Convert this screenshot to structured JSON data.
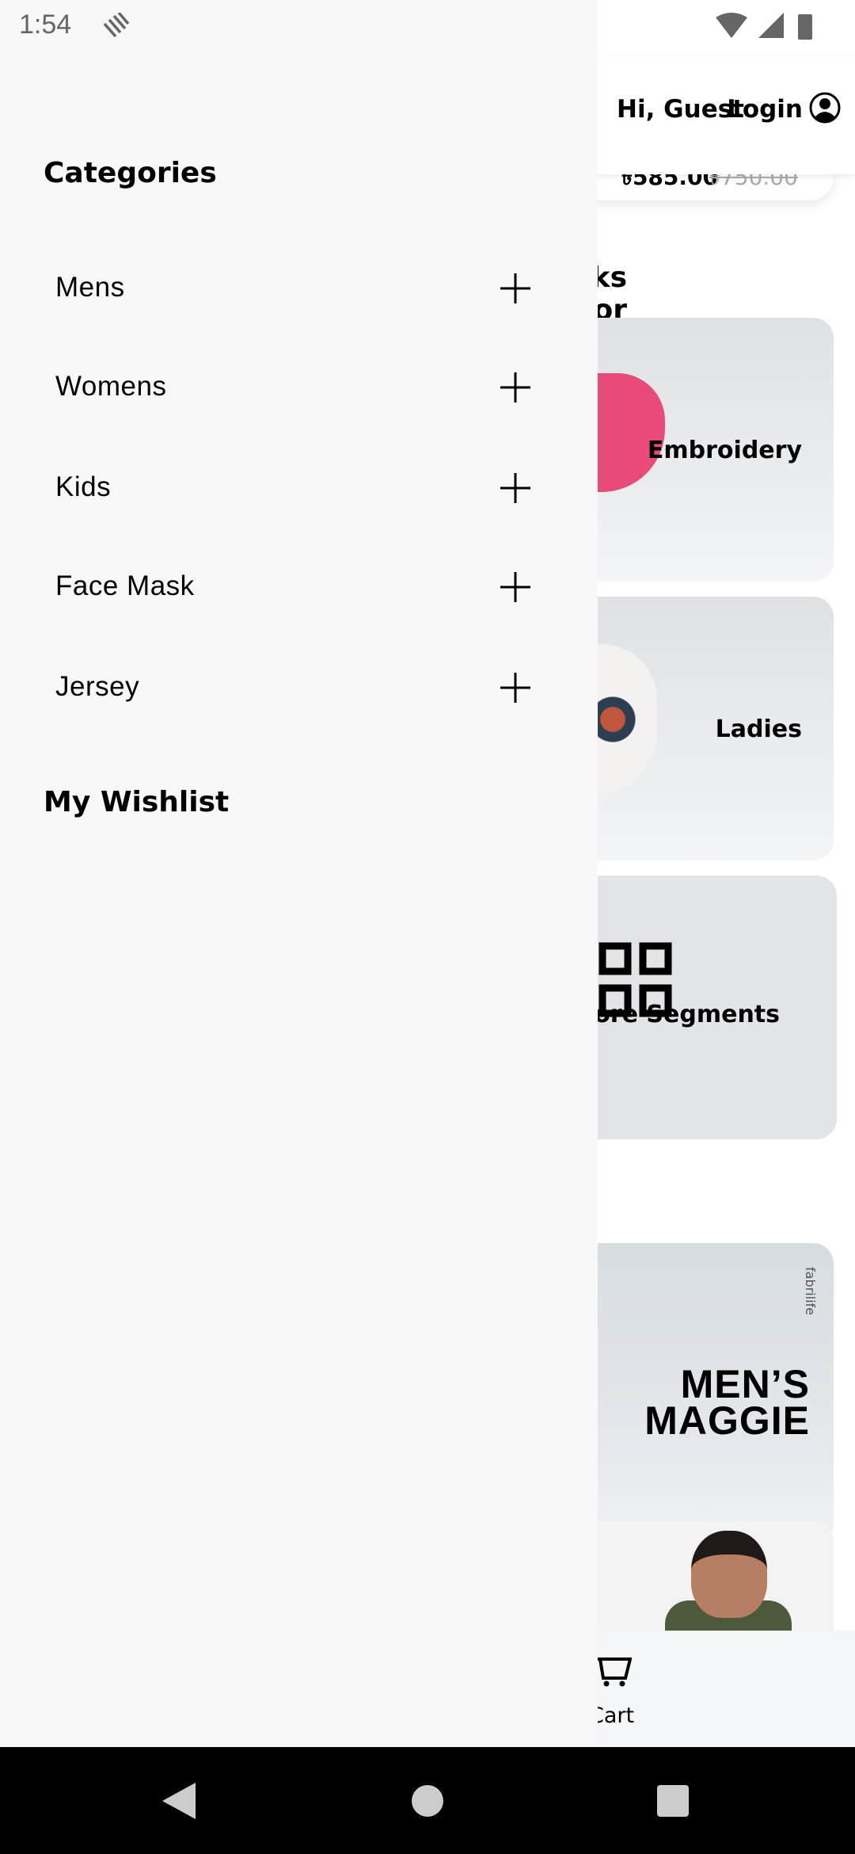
{
  "status_bar": {
    "time": "1:54",
    "icons": [
      "notification-icon",
      "wifi-icon",
      "signal-icon",
      "battery-icon"
    ]
  },
  "header": {
    "greeting": "Hi, Guest",
    "login_label": "Login",
    "icon": "account-circle-icon"
  },
  "price_card": {
    "price": "৳585.00",
    "old_price": "৳750.00"
  },
  "section": {
    "title": "Face Masks For Everyone"
  },
  "segments": [
    {
      "label": "Embroidery"
    },
    {
      "label": "Ladies"
    },
    {
      "label": "View More Segments",
      "icon": "grid-icon"
    }
  ],
  "banner": {
    "brand": "fabrilife",
    "title_line1": "MEN’S",
    "title_line2": "MAGGIE"
  },
  "bottom_nav": {
    "cart_label": "Cart"
  },
  "drawer": {
    "categories_title": "Categories",
    "items": [
      {
        "label": "Mens"
      },
      {
        "label": "Womens"
      },
      {
        "label": "Kids"
      },
      {
        "label": "Face Mask"
      },
      {
        "label": "Jersey"
      }
    ],
    "wishlist_title": "My Wishlist"
  }
}
